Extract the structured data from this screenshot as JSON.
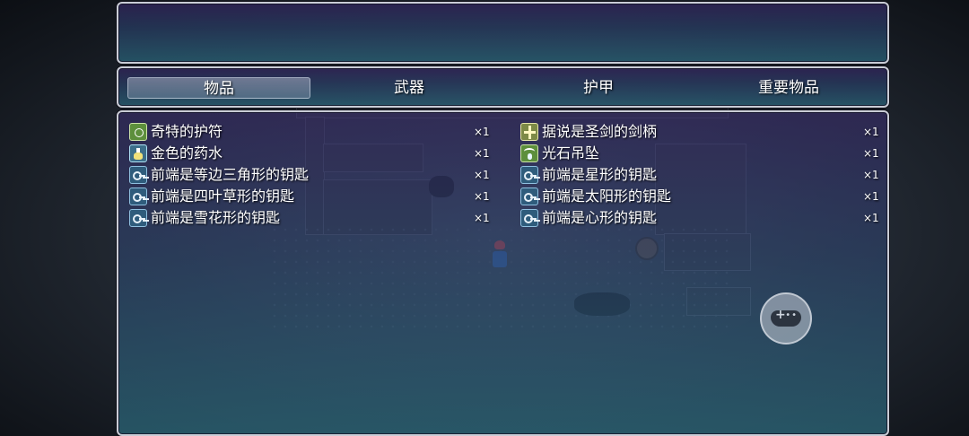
{
  "categories": [
    {
      "label": "物品",
      "selected": true
    },
    {
      "label": "武器",
      "selected": false
    },
    {
      "label": "护甲",
      "selected": false
    },
    {
      "label": "重要物品",
      "selected": false
    }
  ],
  "help_text": "",
  "items": [
    {
      "name": "奇特的护符",
      "qty": "×1",
      "icon": "amulet-icon"
    },
    {
      "name": "据说是圣剑的剑柄",
      "qty": "×1",
      "icon": "sword-hilt-icon"
    },
    {
      "name": "金色的药水",
      "qty": "×1",
      "icon": "potion-icon"
    },
    {
      "name": "光石吊坠",
      "qty": "×1",
      "icon": "pendant-icon"
    },
    {
      "name": "前端是等边三角形的钥匙",
      "qty": "×1",
      "icon": "key-icon"
    },
    {
      "name": "前端是星形的钥匙",
      "qty": "×1",
      "icon": "key-icon"
    },
    {
      "name": "前端是四叶草形的钥匙",
      "qty": "×1",
      "icon": "key-icon"
    },
    {
      "name": "前端是太阳形的钥匙",
      "qty": "×1",
      "icon": "key-icon"
    },
    {
      "name": "前端是雪花形的钥匙",
      "qty": "×1",
      "icon": "key-icon"
    },
    {
      "name": "前端是心形的钥匙",
      "qty": "×1",
      "icon": "key-icon"
    }
  ],
  "gamepad_button": {
    "icon": "gamepad-icon"
  }
}
